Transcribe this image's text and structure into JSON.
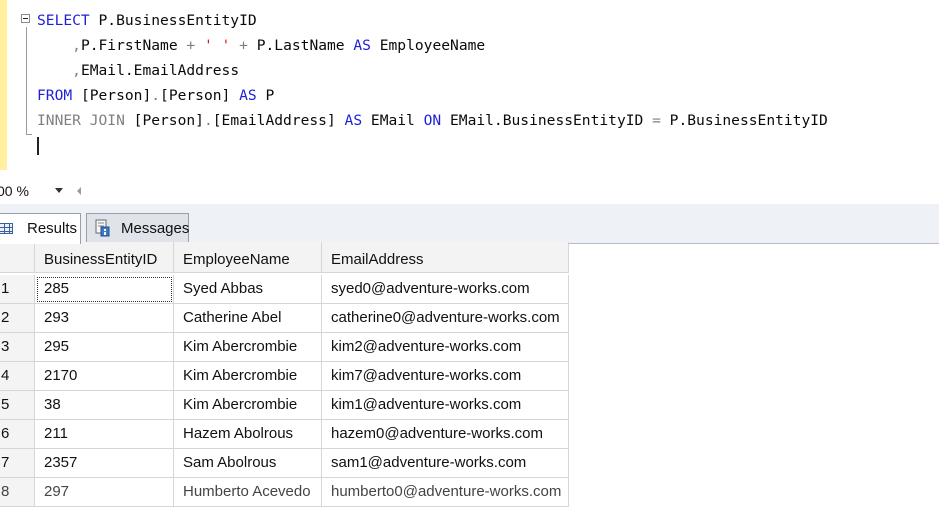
{
  "editor": {
    "line1": {
      "kw1": "SELECT",
      "rest": " P.BusinessEntityID"
    },
    "line2": {
      "comma": ",",
      "p1": "P.FirstName ",
      "plus1": "+",
      "sp": " ",
      "str": "' '",
      "plus2": "+",
      "p2": " P.LastName ",
      "as": "AS",
      "alias": " EmployeeName"
    },
    "line3": {
      "comma": ",",
      "rest": "EMail.EmailAddress"
    },
    "line4": {
      "kw": "FROM",
      "tbl": " [Person]",
      "dot": ".",
      "tbl2": "[Person] ",
      "as": "AS",
      "alias": " P"
    },
    "line5": {
      "kw": "INNER JOIN",
      "tbl": " [Person]",
      "dot": ".",
      "tbl2": "[EmailAddress] ",
      "as": "AS",
      "alias": " EMail ",
      "on": "ON",
      "c1": " EMail.BusinessEntityID ",
      "eq": "=",
      "c2": " P.BusinessEntityID"
    }
  },
  "zoom": {
    "label": "00 %"
  },
  "tabs": {
    "results": "Results",
    "messages": "Messages"
  },
  "grid": {
    "columns": [
      "BusinessEntityID",
      "EmployeeName",
      "EmailAddress"
    ],
    "rows": [
      {
        "n": "1",
        "id": "285",
        "name": "Syed Abbas",
        "email": "syed0@adventure-works.com"
      },
      {
        "n": "2",
        "id": "293",
        "name": "Catherine Abel",
        "email": "catherine0@adventure-works.com"
      },
      {
        "n": "3",
        "id": "295",
        "name": "Kim Abercrombie",
        "email": "kim2@adventure-works.com"
      },
      {
        "n": "4",
        "id": "2170",
        "name": "Kim Abercrombie",
        "email": "kim7@adventure-works.com"
      },
      {
        "n": "5",
        "id": "38",
        "name": "Kim Abercrombie",
        "email": "kim1@adventure-works.com"
      },
      {
        "n": "6",
        "id": "211",
        "name": "Hazem Abolrous",
        "email": "hazem0@adventure-works.com"
      },
      {
        "n": "7",
        "id": "2357",
        "name": "Sam Abolrous",
        "email": "sam1@adventure-works.com"
      },
      {
        "n": "8",
        "id": "297",
        "name": "Humberto Acevedo",
        "email": "humberto0@adventure-works.com"
      }
    ]
  },
  "colors": {
    "keyword": "#1f1fd8",
    "string": "#e01a1a",
    "operator": "#808080",
    "margin": "#ffef9e"
  }
}
